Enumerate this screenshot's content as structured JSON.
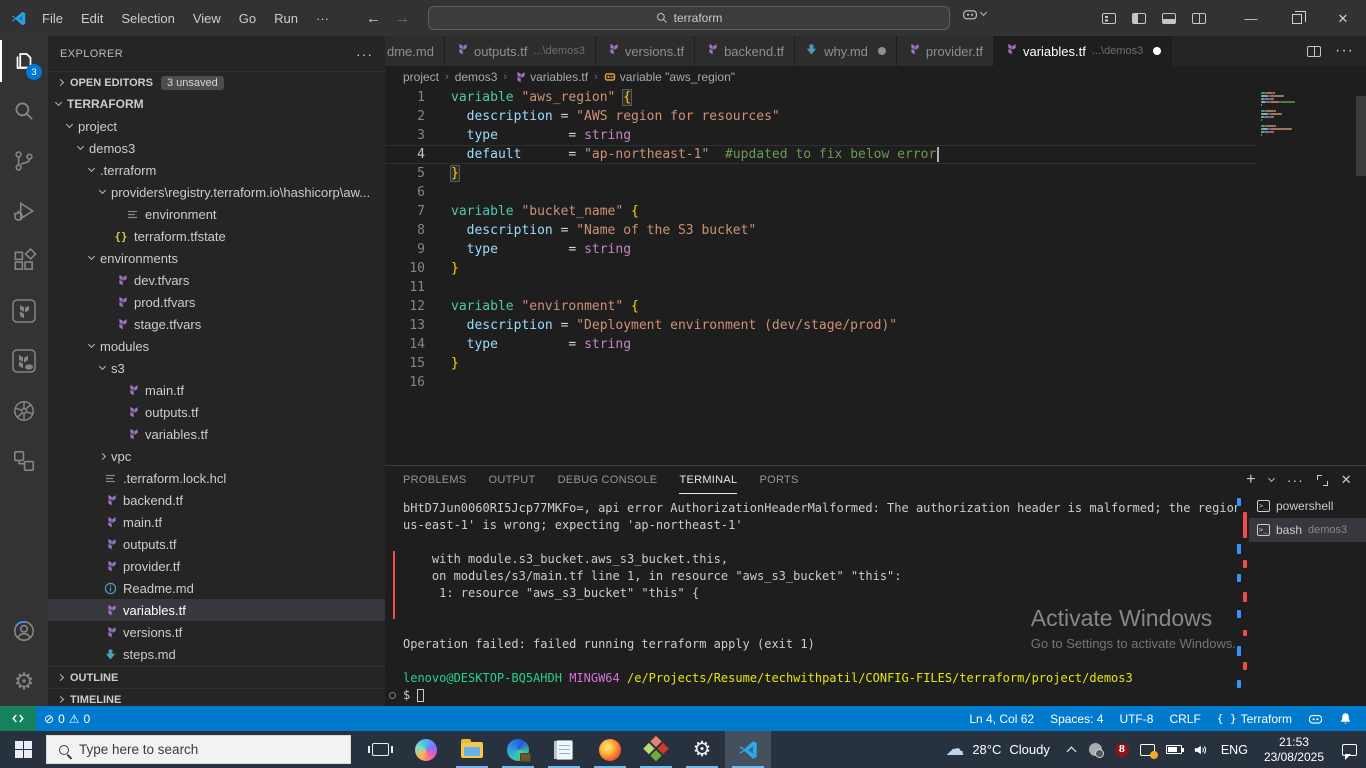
{
  "titlebar": {
    "menus": [
      "File",
      "Edit",
      "Selection",
      "View",
      "Go",
      "Run",
      "···"
    ],
    "search_value": "terraform"
  },
  "activity_bar": {
    "items": [
      {
        "name": "explorer",
        "icon": "files",
        "active": true,
        "badge": "3"
      },
      {
        "name": "search",
        "icon": "search"
      },
      {
        "name": "source-control",
        "icon": "scm"
      },
      {
        "name": "run-debug",
        "icon": "debug"
      },
      {
        "name": "extensions",
        "icon": "ext"
      },
      {
        "name": "terraform",
        "icon": "tfbox"
      },
      {
        "name": "terraform-cloud",
        "icon": "tfcloud"
      },
      {
        "name": "kubernetes",
        "icon": "k8s"
      },
      {
        "name": "remote-explorer",
        "icon": "remote"
      }
    ],
    "bottom": [
      {
        "name": "accounts",
        "icon": "account"
      },
      {
        "name": "settings",
        "icon": "gear"
      }
    ]
  },
  "explorer": {
    "title": "EXPLORER",
    "open_editors": {
      "label": "OPEN EDITORS",
      "badge": "3 unsaved"
    },
    "outline_label": "OUTLINE",
    "timeline_label": "TIMELINE",
    "tree": [
      {
        "label": "TERRAFORM",
        "level": 0,
        "kind": "root",
        "expanded": true
      },
      {
        "label": "project",
        "level": 1,
        "kind": "folder",
        "expanded": true
      },
      {
        "label": "demos3",
        "level": 2,
        "kind": "folder",
        "expanded": true
      },
      {
        "label": ".terraform",
        "level": 3,
        "kind": "folder",
        "expanded": true
      },
      {
        "label": "providers\\registry.terraform.io\\hashicorp\\aw...",
        "level": 4,
        "kind": "folder",
        "expanded": true
      },
      {
        "label": "environment",
        "level": 5,
        "kind": "file",
        "icon": "list"
      },
      {
        "label": "terraform.tfstate",
        "level": 4,
        "kind": "file",
        "icon": "braces"
      },
      {
        "label": "environments",
        "level": 3,
        "kind": "folder",
        "expanded": true
      },
      {
        "label": "dev.tfvars",
        "level": 4,
        "kind": "file",
        "icon": "tf"
      },
      {
        "label": "prod.tfvars",
        "level": 4,
        "kind": "file",
        "icon": "tf"
      },
      {
        "label": "stage.tfvars",
        "level": 4,
        "kind": "file",
        "icon": "tf"
      },
      {
        "label": "modules",
        "level": 3,
        "kind": "folder",
        "expanded": true
      },
      {
        "label": "s3",
        "level": 4,
        "kind": "folder",
        "expanded": true
      },
      {
        "label": "main.tf",
        "level": 5,
        "kind": "file",
        "icon": "tf"
      },
      {
        "label": "outputs.tf",
        "level": 5,
        "kind": "file",
        "icon": "tf"
      },
      {
        "label": "variables.tf",
        "level": 5,
        "kind": "file",
        "icon": "tf"
      },
      {
        "label": "vpc",
        "level": 4,
        "kind": "folder",
        "expanded": false
      },
      {
        "label": ".terraform.lock.hcl",
        "level": 3,
        "kind": "file",
        "icon": "list"
      },
      {
        "label": "backend.tf",
        "level": 3,
        "kind": "file",
        "icon": "tf"
      },
      {
        "label": "main.tf",
        "level": 3,
        "kind": "file",
        "icon": "tf"
      },
      {
        "label": "outputs.tf",
        "level": 3,
        "kind": "file",
        "icon": "tf"
      },
      {
        "label": "provider.tf",
        "level": 3,
        "kind": "file",
        "icon": "tf"
      },
      {
        "label": "Readme.md",
        "level": 3,
        "kind": "file",
        "icon": "info"
      },
      {
        "label": "variables.tf",
        "level": 3,
        "kind": "file",
        "icon": "tf",
        "selected": true
      },
      {
        "label": "versions.tf",
        "level": 3,
        "kind": "file",
        "icon": "tf"
      },
      {
        "label": "steps.md",
        "level": 3,
        "kind": "file",
        "icon": "md"
      }
    ]
  },
  "editor": {
    "tabs": [
      {
        "label": "dme.md",
        "partial": true
      },
      {
        "label": "outputs.tf",
        "dir": "...\\demos3",
        "icon": "tf"
      },
      {
        "label": "versions.tf",
        "icon": "tf"
      },
      {
        "label": "backend.tf",
        "icon": "tf"
      },
      {
        "label": "why.md",
        "icon": "md",
        "modified": true
      },
      {
        "label": "provider.tf",
        "icon": "tf"
      },
      {
        "label": "variables.tf",
        "dir": "...\\demos3",
        "icon": "tf",
        "modified": true,
        "active": true
      }
    ],
    "breadcrumb": [
      {
        "label": "project"
      },
      {
        "label": "demos3"
      },
      {
        "label": "variables.tf",
        "icon": "tf"
      },
      {
        "label": "variable \"aws_region\"",
        "icon": "sym"
      }
    ],
    "code_lines": [
      {
        "tokens": [
          [
            "kw",
            "variable"
          ],
          [
            "pl",
            " "
          ],
          [
            "st",
            "\"aws_region\""
          ],
          [
            "pl",
            " "
          ],
          [
            "mb",
            "{"
          ]
        ]
      },
      {
        "tokens": [
          [
            "pr",
            "  description"
          ],
          [
            "pl",
            " = "
          ],
          [
            "st",
            "\"AWS region for resources\""
          ]
        ]
      },
      {
        "tokens": [
          [
            "pr",
            "  type"
          ],
          [
            "pl",
            "         = "
          ],
          [
            "ty",
            "string"
          ]
        ]
      },
      {
        "tokens": [
          [
            "pr",
            "  default"
          ],
          [
            "pl",
            "      = "
          ],
          [
            "st",
            "\"ap-northeast-1\""
          ],
          [
            "pl",
            "  "
          ],
          [
            "co",
            "#updated to fix below error"
          ]
        ],
        "current": true,
        "cursor": true
      },
      {
        "tokens": [
          [
            "mb",
            "}"
          ]
        ]
      },
      {
        "tokens": []
      },
      {
        "tokens": [
          [
            "kw",
            "variable"
          ],
          [
            "pl",
            " "
          ],
          [
            "st",
            "\"bucket_name\""
          ],
          [
            "pl",
            " "
          ],
          [
            "br",
            "{"
          ]
        ]
      },
      {
        "tokens": [
          [
            "pr",
            "  description"
          ],
          [
            "pl",
            " = "
          ],
          [
            "st",
            "\"Name of the S3 bucket\""
          ]
        ]
      },
      {
        "tokens": [
          [
            "pr",
            "  type"
          ],
          [
            "pl",
            "         = "
          ],
          [
            "ty",
            "string"
          ]
        ]
      },
      {
        "tokens": [
          [
            "br",
            "}"
          ]
        ]
      },
      {
        "tokens": []
      },
      {
        "tokens": [
          [
            "kw",
            "variable"
          ],
          [
            "pl",
            " "
          ],
          [
            "st",
            "\"environment\""
          ],
          [
            "pl",
            " "
          ],
          [
            "br",
            "{"
          ]
        ]
      },
      {
        "tokens": [
          [
            "pr",
            "  description"
          ],
          [
            "pl",
            " = "
          ],
          [
            "st",
            "\"Deployment environment (dev/stage/prod)\""
          ]
        ]
      },
      {
        "tokens": [
          [
            "pr",
            "  type"
          ],
          [
            "pl",
            "         = "
          ],
          [
            "ty",
            "string"
          ]
        ]
      },
      {
        "tokens": [
          [
            "br",
            "}"
          ]
        ]
      },
      {
        "tokens": []
      }
    ]
  },
  "panel": {
    "tabs": [
      {
        "label": "PROBLEMS"
      },
      {
        "label": "OUTPUT"
      },
      {
        "label": "DEBUG CONSOLE"
      },
      {
        "label": "TERMINAL",
        "active": true
      },
      {
        "label": "PORTS"
      }
    ],
    "terminal_lines": [
      {
        "segs": [
          [
            "d",
            "bHtD7Jun0060RI5Jcp77MKFo=, api error AuthorizationHeaderMalformed: The authorization header is malformed; the region '"
          ]
        ]
      },
      {
        "segs": [
          [
            "d",
            "us-east-1' is wrong; expecting 'ap-northeast-1'"
          ]
        ]
      },
      {
        "segs": []
      },
      {
        "err": true,
        "segs": [
          [
            "d",
            "    with module.s3_bucket.aws_s3_bucket.this,"
          ]
        ]
      },
      {
        "err": true,
        "segs": [
          [
            "d",
            "    on modules/s3/main.tf line 1, in resource \"aws_s3_bucket\" \"this\":"
          ]
        ]
      },
      {
        "err": true,
        "segs": [
          [
            "d",
            "     1: resource \"aws_s3_bucket\" \"this\" {"
          ]
        ]
      },
      {
        "err": true,
        "segs": []
      },
      {
        "segs": []
      },
      {
        "segs": [
          [
            "d",
            "Operation failed: failed running terraform apply (exit 1)"
          ]
        ]
      },
      {
        "segs": []
      },
      {
        "segs": [
          [
            "g",
            "lenovo@DESKTOP-BQ5AHDH"
          ],
          [
            "d",
            " "
          ],
          [
            "m",
            "MINGW64"
          ],
          [
            "d",
            " "
          ],
          [
            "y",
            "/e/Projects/Resume/techwithpatil/CONFIG-FILES/terraform/project/demos3"
          ]
        ]
      },
      {
        "cursor": true,
        "segs": [
          [
            "d",
            "$ "
          ]
        ]
      }
    ],
    "terminals": [
      {
        "label": "powershell"
      },
      {
        "label": "bash",
        "sub": "demos3",
        "active": true
      }
    ]
  },
  "watermark": {
    "line1": "Activate Windows",
    "line2": "Go to Settings to activate Windows."
  },
  "status_bar": {
    "errors": "0",
    "warnings": "0",
    "items": [
      {
        "label": "Ln 4, Col 62"
      },
      {
        "label": "Spaces: 4"
      },
      {
        "label": "UTF-8"
      },
      {
        "label": "CRLF"
      },
      {
        "label": "Terraform",
        "icon": "braces"
      }
    ]
  },
  "taskbar": {
    "search_placeholder": "Type here to search",
    "weather_temp": "28°C",
    "weather_condition": "Cloudy",
    "language": "ENG",
    "time": "21:53",
    "date": "23/08/2025"
  }
}
